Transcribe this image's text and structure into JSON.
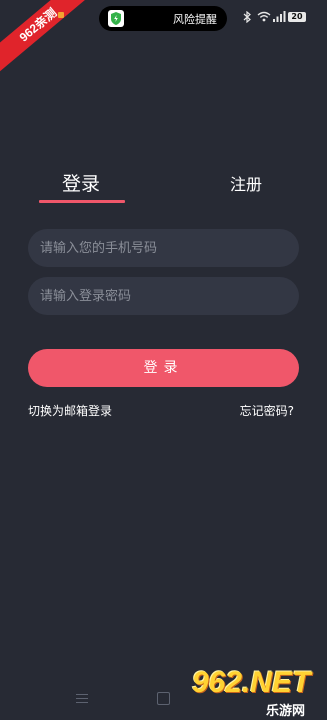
{
  "status_bar": {
    "badge_text": "962",
    "badge_suffix": "亲测",
    "risk_label": "风险提醒",
    "battery": "20",
    "icons": [
      "shield-icon",
      "bluetooth-icon",
      "wifi-icon",
      "signal-icon"
    ]
  },
  "tabs": {
    "login": "登录",
    "register": "注册"
  },
  "form": {
    "phone_placeholder": "请输入您的手机号码",
    "password_placeholder": "请输入登录密码",
    "login_button": "登录",
    "switch_email": "切换为邮箱登录",
    "forgot_password": "忘记密码?"
  },
  "watermark": {
    "main": "962.NET",
    "sub": "乐游网"
  },
  "colors": {
    "background": "#272a34",
    "field": "#333744",
    "accent": "#f0576a"
  }
}
